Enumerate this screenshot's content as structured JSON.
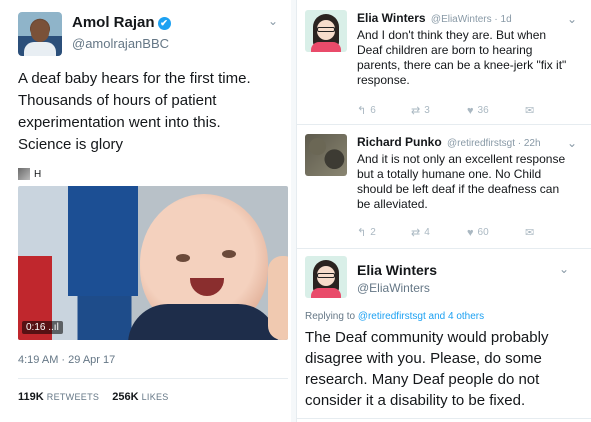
{
  "left_tweet": {
    "author_name": "Amol Rajan",
    "verified_mark": "✔",
    "handle": "@amolrajanBBC",
    "chevron": "⌄",
    "text_lines": [
      "A deaf baby hears for the first time.",
      "Thousands of hours of patient",
      "experimentation went into this.",
      "Science is glory"
    ],
    "quote_label": "H",
    "video_time": "0:16 ..ıl",
    "timestamp": "4:19 AM · 29 Apr 17",
    "retweets_count": "119K",
    "retweets_label": "RETWEETS",
    "likes_count": "256K",
    "likes_label": "LIKES"
  },
  "right_thread": {
    "reply1": {
      "name": "Elia Winters",
      "meta": "@EliaWinters · 1d",
      "text": "And I don't think they are. But when Deaf children are born to hearing parents, there can be a knee-jerk \"fix it\" response.",
      "reply_count": "6",
      "retweet_count": "3",
      "like_count": "36"
    },
    "reply2": {
      "name": "Richard Punko",
      "meta": "@retiredfirstsgt · 22h",
      "text": "And it is not only an excellent response but a totally humane one. No Child should be left deaf if the deafness can be alleviated.",
      "reply_count": "2",
      "retweet_count": "4",
      "like_count": "60"
    },
    "main": {
      "name": "Elia Winters",
      "handle": "@EliaWinters",
      "replying_prefix": "Replying to",
      "replying_targets": "@retiredfirstsgt and 4 others",
      "text": "The Deaf community would probably disagree with you. Please, do some research. Many Deaf people do not consider it a disability to be fixed."
    }
  },
  "icons": {
    "reply": "↰",
    "retweet": "⇄",
    "like": "♥",
    "dm": "✉",
    "chevron": "⌄"
  },
  "colors": {
    "link": "#1da1f2",
    "muted": "#657786",
    "icon": "#aab8c2"
  }
}
